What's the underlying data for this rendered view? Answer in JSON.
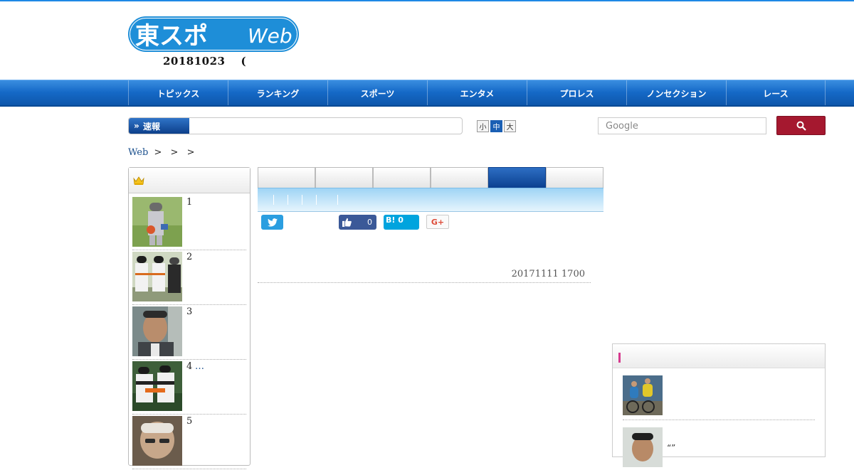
{
  "header": {
    "logo_text": "東スポWeb",
    "date": "20181023",
    "date_suffix": "("
  },
  "nav": {
    "items": [
      "トピックス",
      "ランキング",
      "スポーツ",
      "エンタメ",
      "プロレス",
      "ノンセクション",
      "レース"
    ]
  },
  "breaking": {
    "label": "速報"
  },
  "font_size": {
    "small": "小",
    "medium": "中",
    "large": "大",
    "selected": "中"
  },
  "search": {
    "placeholder": "Google"
  },
  "breadcrumb": {
    "home": "Web",
    "sep1": ">",
    "sep2": ">",
    "sep3": ">"
  },
  "ranking": {
    "items": [
      {
        "rank": "1",
        "text": ""
      },
      {
        "rank": "2",
        "text": ""
      },
      {
        "rank": "3",
        "text": ""
      },
      {
        "rank": "4",
        "text": "…"
      },
      {
        "rank": "5",
        "text": ""
      }
    ]
  },
  "share": {
    "facebook_count": "0",
    "hatena_label": "B!",
    "hatena_count": "0",
    "gplus_label": "G+"
  },
  "article": {
    "date": "20171111 1700"
  },
  "side": {
    "item2_text": "“”"
  },
  "colors": {
    "accent": "#1569c7",
    "search_button": "#a5182f",
    "twitter": "#2b9ee0",
    "facebook": "#3b5998",
    "hatena": "#00a4de"
  }
}
